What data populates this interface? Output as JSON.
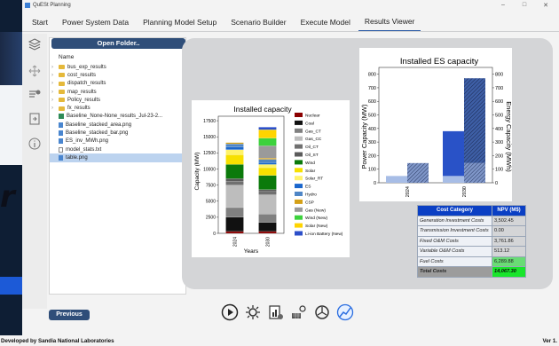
{
  "window": {
    "title": "QuESt Planning",
    "controls": [
      "–",
      "□",
      "✕"
    ]
  },
  "tabs": [
    {
      "label": "Start",
      "active": false
    },
    {
      "label": "Power System Data",
      "active": false
    },
    {
      "label": "Planning Model Setup",
      "active": false
    },
    {
      "label": "Scenario Builder",
      "active": false
    },
    {
      "label": "Execute Model",
      "active": false
    },
    {
      "label": "Results Viewer",
      "active": true
    }
  ],
  "file_panel": {
    "open_folder_label": "Open Folder..",
    "column_header": "Name",
    "items": [
      {
        "label": "bus_exp_results",
        "type": "folder"
      },
      {
        "label": "cost_results",
        "type": "folder"
      },
      {
        "label": "dispatch_results",
        "type": "folder"
      },
      {
        "label": "map_results",
        "type": "folder"
      },
      {
        "label": "Policy_results",
        "type": "folder"
      },
      {
        "label": "fx_results",
        "type": "folder"
      },
      {
        "label": "Baseline_None-None_results_Jul-23-2...",
        "type": "csv"
      },
      {
        "label": "Baseline_stacked_area.png",
        "type": "image"
      },
      {
        "label": "Baseline_stacked_bar.png",
        "type": "image"
      },
      {
        "label": "ES_inv_MWh.png",
        "type": "image"
      },
      {
        "label": "model_stats.txt",
        "type": "text"
      },
      {
        "label": "table.png",
        "type": "image",
        "selected": true
      }
    ]
  },
  "chart_installed_capacity": {
    "title": "Installed capacity",
    "ylabel": "Capacity (MW)",
    "xlabel": "Years",
    "yticks": [
      "0",
      "2500",
      "5000",
      "7500",
      "10000",
      "12500",
      "15000",
      "17500"
    ],
    "legend": [
      {
        "label": "Nuclear",
        "color": "#8b0000"
      },
      {
        "label": "Coal",
        "color": "#111111"
      },
      {
        "label": "Gas_CT",
        "color": "#808080"
      },
      {
        "label": "Gas_CC",
        "color": "#bdbdbd"
      },
      {
        "label": "Oil_CT",
        "color": "#707070"
      },
      {
        "label": "Oil_ST",
        "color": "#5b5b5b"
      },
      {
        "label": "Wind",
        "color": "#0b7a0b"
      },
      {
        "label": "Solar",
        "color": "#f7e000"
      },
      {
        "label": "Solar_RT",
        "color": "#fff36a"
      },
      {
        "label": "ES",
        "color": "#1a66cc"
      },
      {
        "label": "Hydro",
        "color": "#4f86c6"
      },
      {
        "label": "CSP",
        "color": "#d4a017"
      },
      {
        "label": "Gas (New)",
        "color": "#9a9a9a"
      },
      {
        "label": "Wind (New)",
        "color": "#3cd23c"
      },
      {
        "label": "Solar (New)",
        "color": "#ffd400"
      },
      {
        "label": "Li-ion Battery (New)",
        "color": "#2c4fc9"
      }
    ]
  },
  "chart_data": [
    {
      "type": "bar",
      "title": "Installed capacity",
      "xlabel": "Years",
      "ylabel": "Capacity (MW)",
      "categories": [
        "2024",
        "2030"
      ],
      "ylim": [
        0,
        17500
      ],
      "stacked": true,
      "series": [
        {
          "name": "Nuclear",
          "values": [
            300,
            300
          ]
        },
        {
          "name": "Coal",
          "values": [
            2200,
            1400
          ]
        },
        {
          "name": "Gas_CT",
          "values": [
            1500,
            1300
          ]
        },
        {
          "name": "Gas_CC",
          "values": [
            3500,
            3000
          ]
        },
        {
          "name": "Oil_CT",
          "values": [
            600,
            500
          ]
        },
        {
          "name": "Oil_ST",
          "values": [
            400,
            300
          ]
        },
        {
          "name": "Wind",
          "values": [
            2200,
            2200
          ]
        },
        {
          "name": "Solar",
          "values": [
            1500,
            1200
          ]
        },
        {
          "name": "Solar_RT",
          "values": [
            800,
            500
          ]
        },
        {
          "name": "ES",
          "values": [
            400,
            300
          ]
        },
        {
          "name": "Hydro",
          "values": [
            500,
            500
          ]
        },
        {
          "name": "CSP",
          "values": [
            200,
            200
          ]
        },
        {
          "name": "Gas (New)",
          "values": [
            0,
            1900
          ]
        },
        {
          "name": "Wind (New)",
          "values": [
            0,
            1200
          ]
        },
        {
          "name": "Solar (New)",
          "values": [
            0,
            1300
          ]
        },
        {
          "name": "Li-ion Battery (New)",
          "values": [
            0,
            400
          ]
        }
      ]
    },
    {
      "type": "bar",
      "title": "Installed ES capacity",
      "ylabel": "Power Capacity (MW)",
      "y2label": "Energy Capacity (MWh)",
      "categories": [
        "2024",
        "2030"
      ],
      "ylim": [
        0,
        850
      ],
      "y2lim": [
        0,
        850
      ],
      "series": [
        {
          "name": "Power existing",
          "values": [
            50,
            50
          ]
        },
        {
          "name": "Power new",
          "values": [
            0,
            330
          ]
        },
        {
          "name": "Energy existing",
          "values": [
            145,
            145
          ]
        },
        {
          "name": "Energy new",
          "values": [
            0,
            625
          ]
        }
      ]
    }
  ],
  "chart_es": {
    "title": "Installed ES capacity",
    "ylabel": "Power Capacity (MW)",
    "y2label": "Energy Capacity (MWh)",
    "yticks": [
      "0",
      "100",
      "200",
      "300",
      "400",
      "500",
      "600",
      "700",
      "800"
    ],
    "categories": [
      "2024",
      "2030"
    ]
  },
  "npv_table": {
    "header_category": "Cost Category",
    "header_value": "NPV (M$)",
    "rows": [
      {
        "category": "Generation Investment Costs",
        "value": "3,502.45"
      },
      {
        "category": "Transmission Investment Costs",
        "value": "0.00"
      },
      {
        "category": "Fixed O&M Costs",
        "value": "3,761.86"
      },
      {
        "category": "Variable O&M Costs",
        "value": "513.12"
      },
      {
        "category": "Fuel Costs",
        "value": "6,289.88"
      },
      {
        "category": "Total Costs",
        "value": "14,067.30"
      }
    ]
  },
  "buttons": {
    "previous_label": "Previous"
  },
  "bottom_icons": [
    "play-icon",
    "gear-network-icon",
    "document-chart-icon",
    "solar-gear-icon",
    "wind-gear-icon",
    "chart-icon"
  ],
  "status": {
    "left": "Developed by Sandia National Laboratories",
    "right": "Ver 1."
  },
  "colors": {
    "accent": "#2f4e79",
    "tab_active": "#2b5aa6",
    "table_header": "#0a3fc4",
    "total_green": "#19e52c"
  }
}
